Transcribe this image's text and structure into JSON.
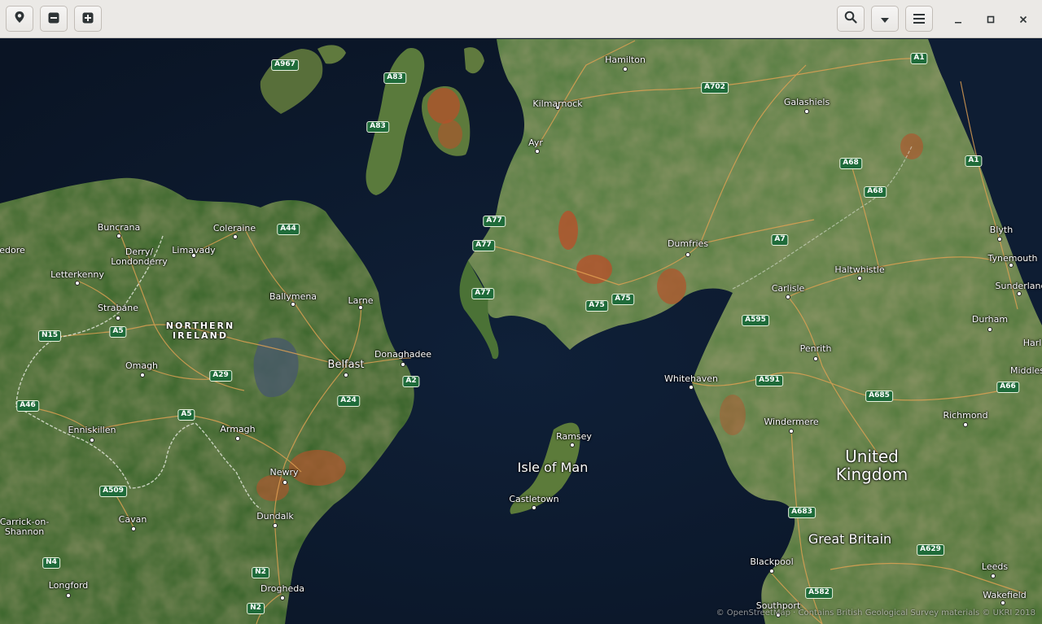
{
  "toolbar": {
    "location_icon": "map-marker-icon",
    "zoom_out_icon": "zoom-out-icon",
    "zoom_in_icon": "zoom-in-icon",
    "search_icon": "search-icon",
    "dropdown_icon": "chevron-down-icon",
    "menu_icon": "hamburger-menu-icon",
    "minimize_icon": "minimize-icon",
    "maximize_icon": "maximize-icon",
    "close_icon": "close-icon"
  },
  "places": [
    {
      "name": "Hamilton"
    },
    {
      "name": "Kilmarnock"
    },
    {
      "name": "Galashiels"
    },
    {
      "name": "Ayr"
    },
    {
      "name": "Buncrana"
    },
    {
      "name": "Derry/\nLondonderry"
    },
    {
      "name": "Limavady"
    },
    {
      "name": "Coleraine"
    },
    {
      "name": "edore"
    },
    {
      "name": "Letterkenny"
    },
    {
      "name": "Strabane"
    },
    {
      "name": "Ballymena"
    },
    {
      "name": "Larne"
    },
    {
      "name": "NORTHERN\nIRELAND"
    },
    {
      "name": "Omagh"
    },
    {
      "name": "Belfast"
    },
    {
      "name": "Donaghadee"
    },
    {
      "name": "Enniskillen"
    },
    {
      "name": "Armagh"
    },
    {
      "name": "Newry"
    },
    {
      "name": "Dundalk"
    },
    {
      "name": "Cavan"
    },
    {
      "name": "Carrick-on-\nShannon"
    },
    {
      "name": "Longford"
    },
    {
      "name": "Drogheda"
    },
    {
      "name": "Dumfries"
    },
    {
      "name": "Blyth"
    },
    {
      "name": "Tynemouth"
    },
    {
      "name": "Haltwhistle"
    },
    {
      "name": "Carlisle"
    },
    {
      "name": "Sunderland"
    },
    {
      "name": "Durham"
    },
    {
      "name": "Penrith"
    },
    {
      "name": "Whitehaven"
    },
    {
      "name": "Middles"
    },
    {
      "name": "Harl"
    },
    {
      "name": "Ramsey"
    },
    {
      "name": "Isle of Man"
    },
    {
      "name": "Castletown"
    },
    {
      "name": "Windermere"
    },
    {
      "name": "Richmond"
    },
    {
      "name": "United\nKingdom"
    },
    {
      "name": "Great Britain"
    },
    {
      "name": "Blackpool"
    },
    {
      "name": "Leeds"
    },
    {
      "name": "Wakefield"
    },
    {
      "name": "Southport"
    }
  ],
  "roads": [
    "A967",
    "A83",
    "A83",
    "A1",
    "A702",
    "A68",
    "A68",
    "A1",
    "A77",
    "A77",
    "A77",
    "A75",
    "A75",
    "A7",
    "A44",
    "N15",
    "A5",
    "A29",
    "A2",
    "A46",
    "A5",
    "A24",
    "A509",
    "N2",
    "N2",
    "N4",
    "A595",
    "A591",
    "A685",
    "A66",
    "A683",
    "A629",
    "A582"
  ],
  "attribution": "© OpenStreetMap · Contains British Geological Survey materials © UKRI 2018"
}
